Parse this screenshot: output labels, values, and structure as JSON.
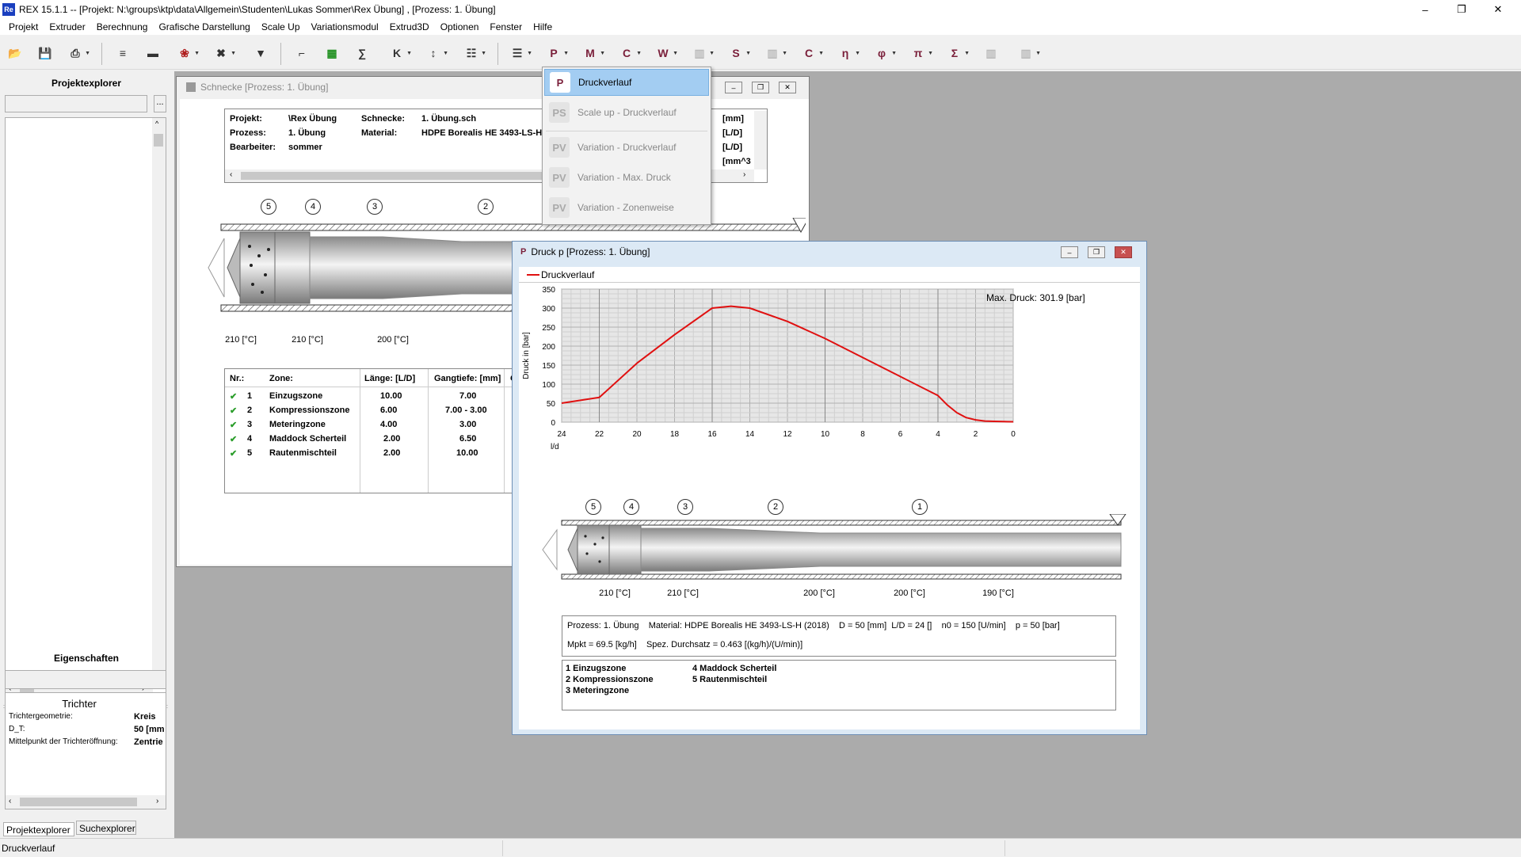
{
  "window": {
    "title": "REX 15.1.1 -- [Projekt: N:\\groups\\ktp\\data\\Allgemein\\Studenten\\Lukas Sommer\\Rex Übung] , [Prozess: 1. Übung]",
    "app_icon": "Re"
  },
  "menu": [
    "Projekt",
    "Extruder",
    "Berechnung",
    "Grafische Darstellung",
    "Scale Up",
    "Variationsmodul",
    "Extrud3D",
    "Optionen",
    "Fenster",
    "Hilfe"
  ],
  "left": {
    "projektexplorer": "Projektexplorer",
    "search_btn": "...",
    "eigenschaften": "Eigenschaften",
    "trichter": "Trichter",
    "props": [
      {
        "k": "Trichtergeometrie:",
        "v": "Kreis"
      },
      {
        "k": "D_T:",
        "v": "50 [mm"
      },
      {
        "k": "Mittelpunkt der Trichteröffnung:",
        "v": "Zentrie"
      }
    ],
    "tabs": [
      "Projektexplorer",
      "Suchexplorer"
    ]
  },
  "schnecke": {
    "title": "Schnecke [Prozess: 1. Übung]",
    "info": {
      "projekt_l": "Projekt:",
      "projekt_v": "\\Rex Übung",
      "prozess_l": "Prozess:",
      "prozess_v": "1. Übung",
      "bearbeiter_l": "Bearbeiter:",
      "bearbeiter_v": "sommer",
      "schnecke_l": "Schnecke:",
      "schnecke_v": "1. Übung.sch",
      "material_l": "Material:",
      "material_v": "HDPE Borealis HE 3493-LS-H (",
      "u1": "[mm]",
      "u2": "[L/D]",
      "u3": "[L/D]",
      "u4": "[mm^3"
    },
    "zones": [
      "5",
      "4",
      "3",
      "2"
    ],
    "temps": [
      "210 [°C]",
      "210 [°C]",
      "200 [°C]"
    ],
    "table": {
      "headers": [
        "Nr.:",
        "Zone:",
        "Länge: [L/D]",
        "Gangtiefe: [mm]",
        "Ga"
      ],
      "rows": [
        [
          "1",
          "Einzugszone",
          "10.00",
          "7.00"
        ],
        [
          "2",
          "Kompressionszone",
          "6.00",
          "7.00 - 3.00"
        ],
        [
          "3",
          "Meteringzone",
          "4.00",
          "3.00"
        ],
        [
          "4",
          "Maddock Scherteil",
          "2.00",
          "6.50"
        ],
        [
          "5",
          "Rautenmischteil",
          "2.00",
          "10.00"
        ]
      ]
    }
  },
  "dropdown": [
    {
      "label": "Druckverlauf",
      "icon": "P",
      "enabled": true
    },
    {
      "label": "Scale up - Druckverlauf",
      "icon": "PS",
      "enabled": false
    },
    {
      "label": "Variation - Druckverlauf",
      "icon": "PV",
      "enabled": false
    },
    {
      "label": "Variation - Max. Druck",
      "icon": "PV",
      "enabled": false
    },
    {
      "label": "Variation - Zonenweise",
      "icon": "PV",
      "enabled": false
    }
  ],
  "druck": {
    "title": "Druck p [Prozess: 1. Übung]",
    "legend": "Druckverlauf",
    "maxlabel": "Max. Druck: 301.9 [bar]",
    "zones": [
      "5",
      "4",
      "3",
      "2",
      "1"
    ],
    "temps": [
      "210 [°C]",
      "210 [°C]",
      "200 [°C]",
      "200 [°C]",
      "190 [°C]"
    ],
    "info1": "Prozess: 1. Übung    Material: HDPE Borealis HE 3493-LS-H (2018)    D = 50 [mm]  L/D = 24 []    n0 = 150 [U/min]    p = 50 [bar]",
    "info2": "Mpkt = 69.5 [kg/h]    Spez. Durchsatz = 0.463 [(kg/h)/(U/min)]",
    "zonelist": [
      "1  Einzugszone",
      "2  Kompressionszone",
      "3  Meteringzone",
      "4  Maddock Scherteil",
      "5  Rautenmischteil"
    ]
  },
  "chart_data": {
    "type": "line",
    "ylabel": "Druck in [bar]",
    "xlabel": "l/d",
    "xlim": [
      24,
      0
    ],
    "ylim": [
      0,
      350
    ],
    "xticks": [
      24,
      22,
      20,
      18,
      16,
      14,
      12,
      10,
      8,
      6,
      4,
      2,
      0
    ],
    "yticks": [
      0,
      50,
      100,
      150,
      200,
      250,
      300,
      350
    ],
    "series": [
      {
        "name": "Druckverlauf",
        "color": "#e01010",
        "x": [
          24,
          22,
          20,
          18,
          16,
          15,
          14,
          12,
          10,
          8,
          6,
          4,
          3.5,
          3,
          2.5,
          2,
          1.5,
          1,
          0.5,
          0
        ],
        "y": [
          50,
          65,
          155,
          230,
          300,
          305,
          300,
          265,
          220,
          170,
          120,
          70,
          45,
          25,
          12,
          6,
          3,
          2,
          1.5,
          1
        ]
      }
    ]
  },
  "status": "Druckverlauf"
}
